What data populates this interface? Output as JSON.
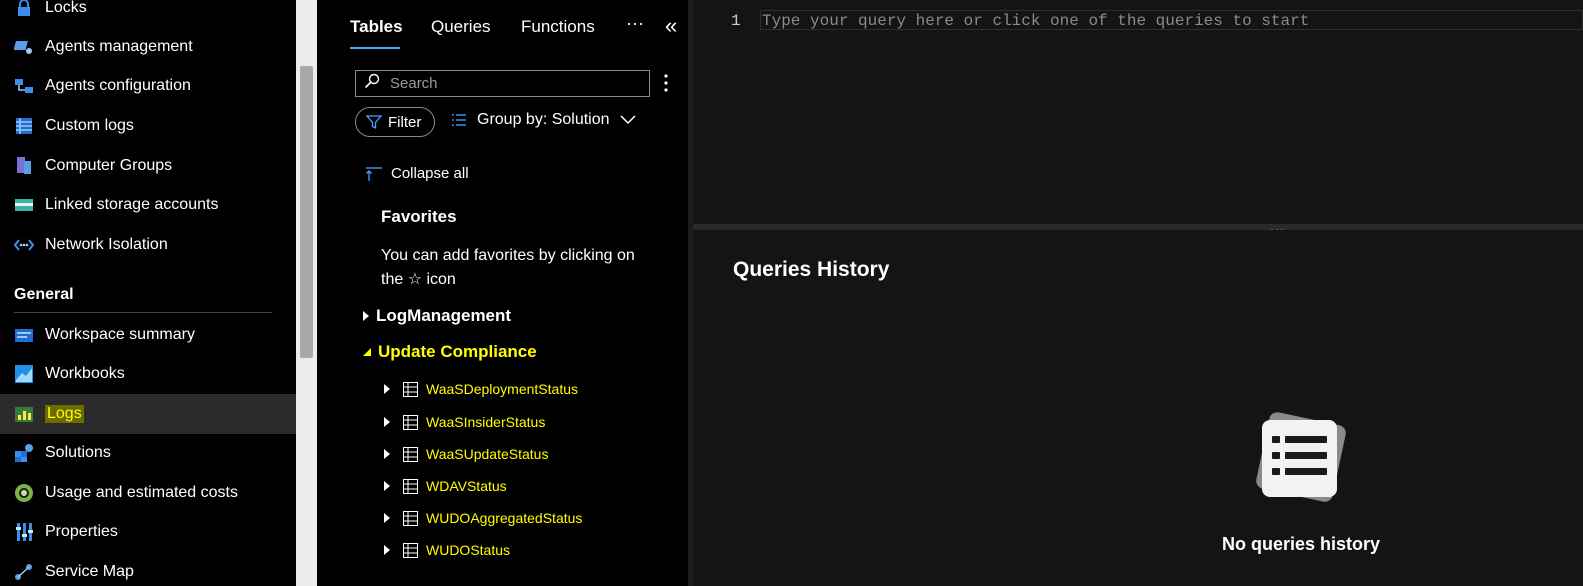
{
  "sidebar": {
    "items": [
      {
        "label": "Locks",
        "icon": "lock-icon"
      },
      {
        "label": "Agents management",
        "icon": "agents-management-icon"
      },
      {
        "label": "Agents configuration",
        "icon": "agents-configuration-icon"
      },
      {
        "label": "Custom logs",
        "icon": "custom-logs-icon"
      },
      {
        "label": "Computer Groups",
        "icon": "computer-groups-icon"
      },
      {
        "label": "Linked storage accounts",
        "icon": "storage-icon"
      },
      {
        "label": "Network Isolation",
        "icon": "network-icon"
      }
    ],
    "section_general": "General",
    "general_items": [
      {
        "label": "Workspace summary",
        "icon": "workspace-summary-icon"
      },
      {
        "label": "Workbooks",
        "icon": "workbooks-icon"
      },
      {
        "label": "Logs",
        "icon": "logs-icon",
        "active": true
      },
      {
        "label": "Solutions",
        "icon": "solutions-icon"
      },
      {
        "label": "Usage and estimated costs",
        "icon": "usage-costs-icon"
      },
      {
        "label": "Properties",
        "icon": "properties-icon"
      },
      {
        "label": "Service Map",
        "icon": "service-map-icon"
      }
    ]
  },
  "schema": {
    "tabs": [
      "Tables",
      "Queries",
      "Functions"
    ],
    "more": "···",
    "collapse_panel": "«",
    "search_placeholder": "Search",
    "filter_label": "Filter",
    "groupby_label": "Group by: Solution",
    "collapse_all": "Collapse all",
    "favorites_title": "Favorites",
    "favorites_text_1": "You can add favorites by clicking on",
    "favorites_text_2": "the ☆ icon",
    "groups": [
      {
        "label": "LogManagement",
        "expanded": false
      },
      {
        "label": "Update Compliance",
        "expanded": true
      }
    ],
    "tables": [
      "WaaSDeploymentStatus",
      "WaaSInsiderStatus",
      "WaaSUpdateStatus",
      "WDAVStatus",
      "WUDOAggregatedStatus",
      "WUDOStatus"
    ]
  },
  "editor": {
    "line_number": "1",
    "placeholder": "Type your query here or click one of the queries to start"
  },
  "history": {
    "title": "Queries History",
    "empty_text": "No queries history"
  },
  "colors": {
    "highlight": "#ffff00",
    "accent": "#4aa3ff"
  }
}
